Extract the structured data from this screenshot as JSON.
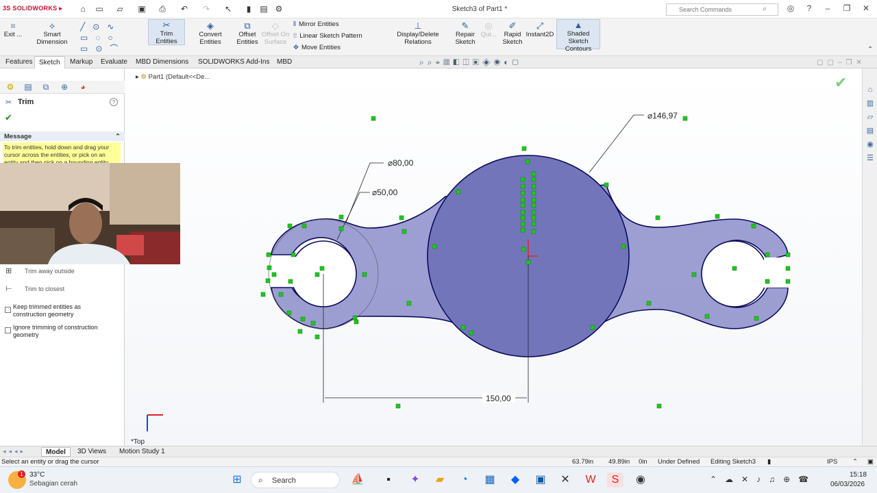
{
  "app": {
    "logo_text": "SOLIDWORKS",
    "document_title": "Sketch3 of Part1 *",
    "search_placeholder": "Search Commands"
  },
  "ribbon": {
    "exit_sketch": "Exit ...",
    "smart_dimension": "Smart Dimension",
    "trim_entities": "Trim Entities",
    "convert_entities": "Convert Entities",
    "offset_entities_1": "Offset",
    "offset_entities_2": "Entities",
    "offset_on_surface_1": "Offset On",
    "offset_on_surface_2": "Surface",
    "mirror_entities": "Mirror Entities",
    "linear_sketch_pattern": "Linear Sketch Pattern",
    "move_entities": "Move Entities",
    "display_delete_relations": "Display/Delete Relations",
    "repair_sketch_1": "Repair",
    "repair_sketch_2": "Sketch",
    "quick_snaps": "Qui...",
    "rapid_sketch_1": "Rapid",
    "rapid_sketch_2": "Sketch",
    "instant2d": "Instant2D",
    "shaded_contours_1": "Shaded Sketch",
    "shaded_contours_2": "Contours"
  },
  "command_tabs": [
    "Features",
    "Sketch",
    "Markup",
    "Evaluate",
    "MBD Dimensions",
    "SOLIDWORKS Add-Ins",
    "MBD"
  ],
  "active_tab": "Sketch",
  "property_manager": {
    "title": "Trim",
    "message_header": "Message",
    "message_text": "To trim entities, hold down and drag your cursor across the entities, or pick on an entity and then pick on a bounding entity.",
    "options": {
      "trim_away_outside": "Trim away outside",
      "trim_to_closest": "Trim to closest"
    },
    "keep_trimmed": "Keep trimmed entities as construction geometry",
    "ignore_trimming": "Ignore trimming of construction geometry"
  },
  "breadcrumb": "Part1 (Default<<De...",
  "view_label": "*Top",
  "dimensions": {
    "dia_large": "⌀146,97",
    "dia_80": "⌀80,00",
    "dia_50": "⌀50,00",
    "distance": "150,00"
  },
  "bottom_tabs": [
    "Model",
    "3D Views",
    "Motion Study 1"
  ],
  "status_bar": {
    "prompt": "Select an entity or drag the cursor",
    "x": "63.79in",
    "y": "49.89in",
    "z": "0in",
    "state": "Under Defined",
    "editing": "Editing Sketch3",
    "units": "IPS"
  },
  "taskbar": {
    "weather_temp": "33°C",
    "weather_desc": "Sebagian cerah",
    "search": "Search",
    "time": "15:18",
    "date": "06/03/2026",
    "weather_badge": "1"
  },
  "colors": {
    "accent": "#2d5f9a",
    "sketch_fill": "#7a7cc0",
    "relation_green": "#1ec81e"
  }
}
